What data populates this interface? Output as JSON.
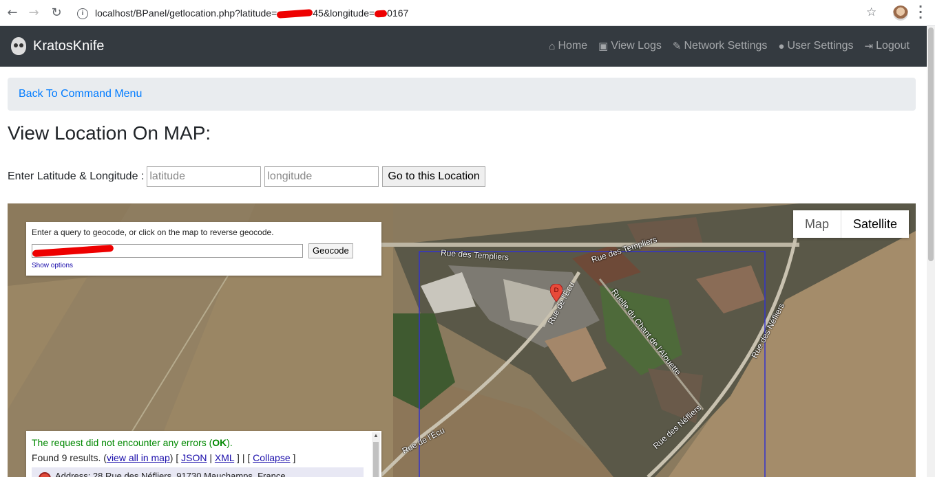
{
  "browser": {
    "url_prefix": "localhost/BPanel/getlocation.php?latitude=",
    "url_mid": "45&longitude=",
    "url_suffix": "0167"
  },
  "navbar": {
    "brand": "KratosKnife",
    "links": [
      {
        "label": "Home",
        "icon": "home-icon"
      },
      {
        "label": "View Logs",
        "icon": "clipboard-icon"
      },
      {
        "label": "Network Settings",
        "icon": "wrench-icon"
      },
      {
        "label": "User Settings",
        "icon": "user-icon"
      },
      {
        "label": "Logout",
        "icon": "sign-out-icon"
      }
    ]
  },
  "breadcrumb": {
    "link": "Back To Command Menu"
  },
  "page": {
    "title": "View Location On MAP:",
    "form_label": "Enter Latitude & Longitude :",
    "lat_placeholder": "latitude",
    "lng_placeholder": "longitude",
    "submit_label": "Go to this Location"
  },
  "map": {
    "type_map": "Map",
    "type_satellite": "Satellite",
    "geocode_hint": "Enter a query to geocode, or click on the map to reverse geocode.",
    "geocode_button": "Geocode",
    "show_options": "Show options",
    "status_text": "The request did not encounter any errors (",
    "status_ok": "OK",
    "status_end": ").",
    "found_text": "Found 9 results. (",
    "view_all": "view all in map",
    "json": "JSON",
    "xml": "XML",
    "collapse": "Collapse",
    "first_result": "Address: 28 Rue des Néfliers, 91730 Mauchamps, France",
    "marker_label": "D",
    "streets": [
      "Rue des Templiers",
      "Rue des Templiers",
      "Rue de l'Écu",
      "Ruelle du Chant de l'Alouette",
      "Rue des Néfliers",
      "Rue de l'Écu",
      "Rue des Néfliers"
    ]
  },
  "colors": {
    "navbar": "#343a40",
    "link": "#007bff",
    "ok": "#008800",
    "bounds": "#3333cc"
  }
}
